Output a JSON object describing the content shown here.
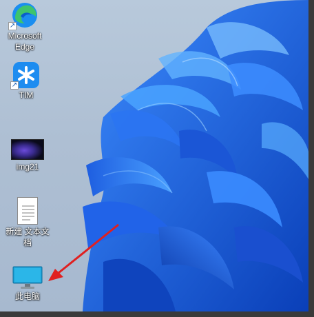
{
  "desktop_icons": {
    "edge": {
      "label": "Microsoft Edge"
    },
    "tim": {
      "label": "TIM"
    },
    "img21": {
      "label": "img21"
    },
    "text_file": {
      "label": "新建 文本文档"
    },
    "this_pc": {
      "label": "此电脑"
    }
  },
  "colors": {
    "wallpaper_bg": "#aebfd3",
    "bloom_primary": "#1f66e6",
    "annotation_arrow": "#e02020"
  },
  "icons": {
    "edge": "edge-logo",
    "tim": "tim-logo",
    "img21": "image-thumbnail",
    "text_file": "text-document",
    "this_pc": "monitor",
    "shortcut": "shortcut-arrow"
  }
}
